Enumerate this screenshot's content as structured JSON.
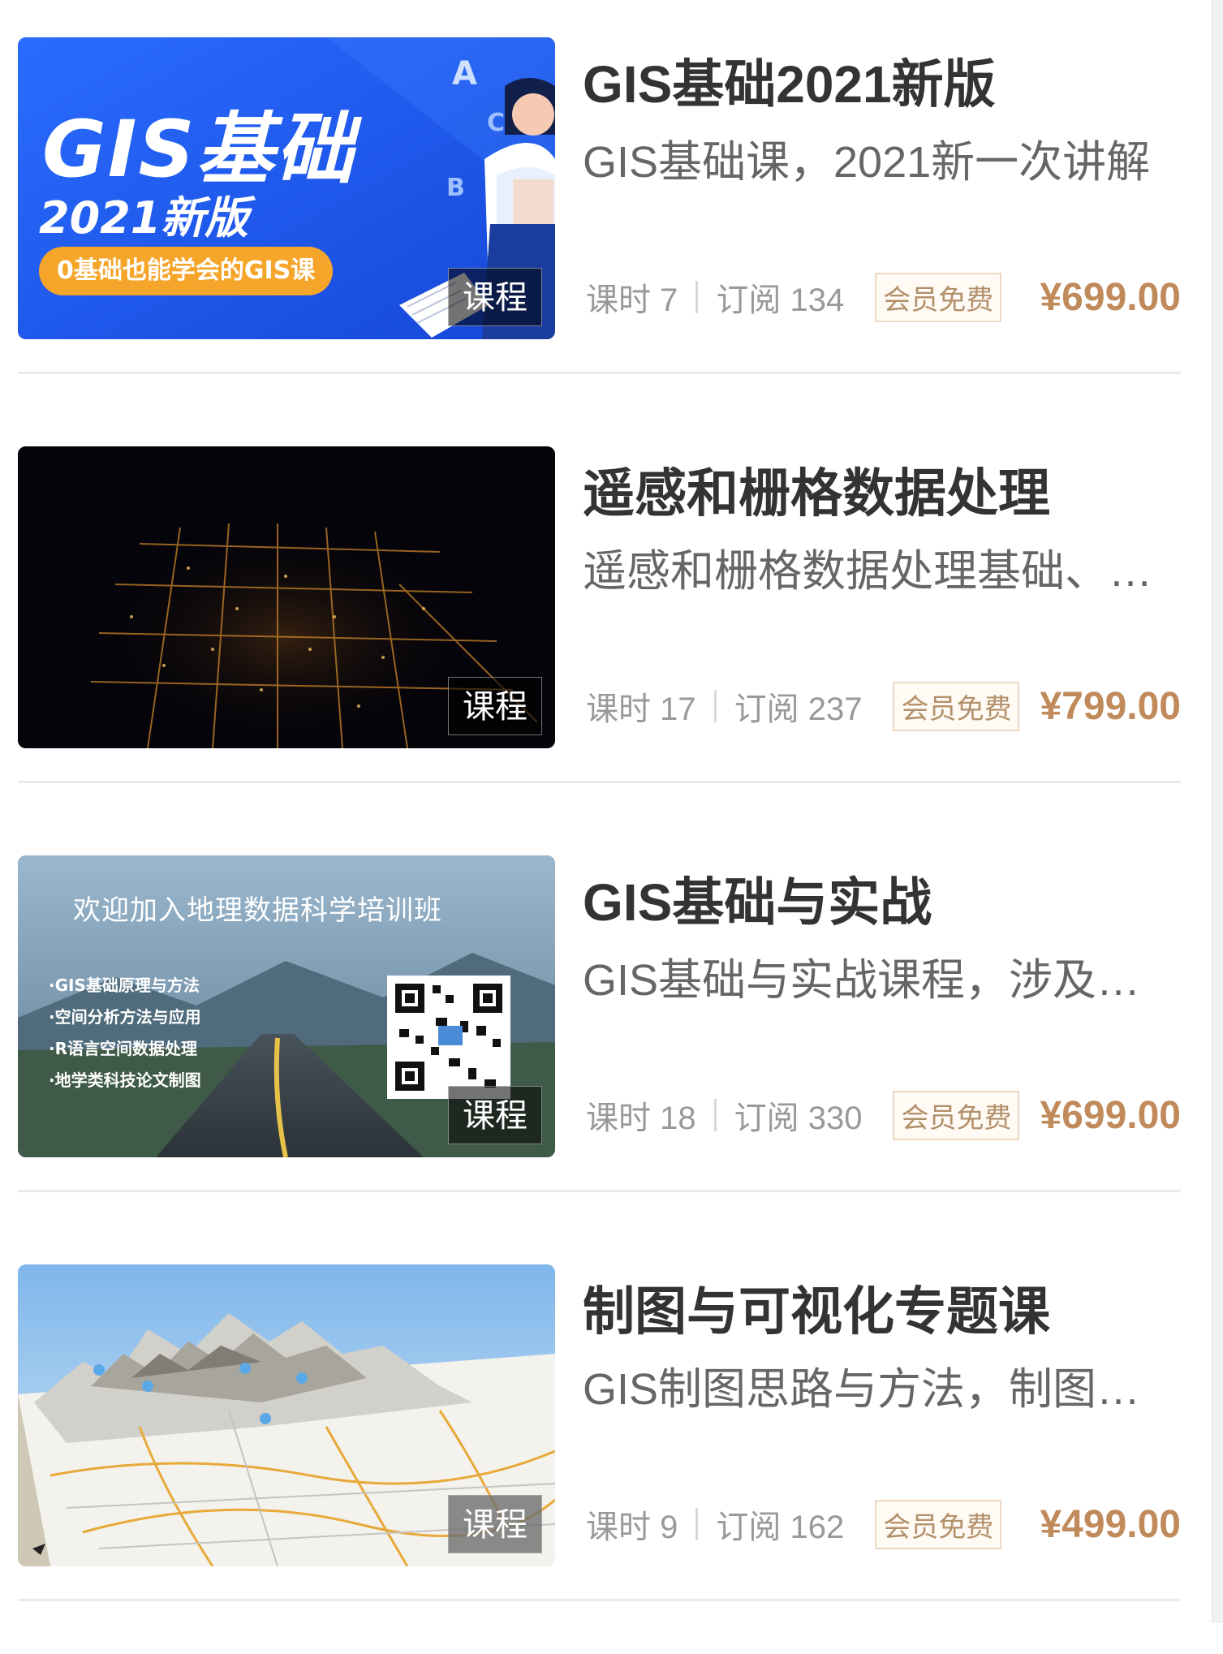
{
  "badge_label": "课程",
  "vip_label": "会员免费",
  "hours_prefix": "课时",
  "subs_prefix": "订阅",
  "courses": [
    {
      "title": "GIS基础2021新版",
      "description": "GIS基础课，2021新一次讲解",
      "hours": "课时 7",
      "subscribers": "订阅 134",
      "price": "¥699.00",
      "thumb": {
        "headline": "GIS基础",
        "subline": "2021新版",
        "pill": "0基础也能学会的GIS课",
        "letters": [
          "A",
          "C",
          "B"
        ],
        "bg": "#1c5cf2",
        "pill_color": "#f6a52b"
      }
    },
    {
      "title": "遥感和栅格数据处理",
      "description": "遥感和栅格数据处理基础、…",
      "hours": "课时 17",
      "subscribers": "订阅 237",
      "price": "¥799.00",
      "thumb": {
        "bg": "#05040a"
      }
    },
    {
      "title": "GIS基础与实战",
      "description": "GIS基础与实战课程，涉及…",
      "hours": "课时 18",
      "subscribers": "订阅 330",
      "price": "¥699.00",
      "thumb": {
        "banner": "欢迎加入地理数据科学培训班",
        "bullets": [
          "·GIS基础原理与方法",
          "·空间分析方法与应用",
          "·R语言空间数据处理",
          "·地学类科技论文制图"
        ]
      }
    },
    {
      "title": "制图与可视化专题课",
      "description": "GIS制图思路与方法，制图…",
      "hours": "课时 9",
      "subscribers": "订阅 162",
      "price": "¥499.00",
      "thumb": {
        "bg": "#9cc8f0"
      }
    }
  ],
  "colors": {
    "title": "#333333",
    "description": "#666666",
    "meta": "#999999",
    "price": "#c08a5a",
    "vip_text": "#b2906b",
    "divider": "#ebebeb"
  }
}
